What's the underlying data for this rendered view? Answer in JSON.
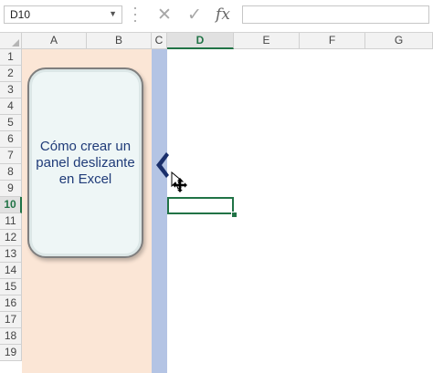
{
  "formula_bar": {
    "name_box": "D10",
    "cancel_icon": "x-icon",
    "enter_icon": "check-icon",
    "function_label": "fx",
    "formula_value": ""
  },
  "columns": [
    "A",
    "B",
    "C",
    "D",
    "E",
    "F",
    "G"
  ],
  "active_column": "D",
  "rows": [
    "1",
    "2",
    "3",
    "4",
    "5",
    "6",
    "7",
    "8",
    "9",
    "10",
    "11",
    "12",
    "13",
    "14",
    "15",
    "16",
    "17",
    "18",
    "19"
  ],
  "active_row": "10",
  "panel": {
    "text": "Cómo crear un panel deslizante en Excel",
    "background_color": "#fbe6d6",
    "divider_color": "#b4c4e4",
    "toggle_icon": "chevron-left-icon"
  },
  "selected_cell": "D10",
  "accent_color": "#217346"
}
